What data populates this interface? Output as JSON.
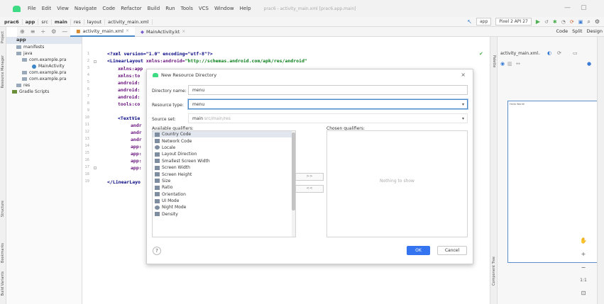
{
  "window": {
    "title": "prac6 - activity_main.xml [prac6.app.main]",
    "menu": [
      "File",
      "Edit",
      "View",
      "Navigate",
      "Code",
      "Refactor",
      "Build",
      "Run",
      "Tools",
      "VCS",
      "Window",
      "Help"
    ]
  },
  "breadcrumbs": [
    "prac6",
    "app",
    "src",
    "main",
    "res",
    "layout",
    "activity_main.xml"
  ],
  "toolbar": {
    "module": "app",
    "device": "Pixel 2 API 27"
  },
  "tabs": [
    {
      "label": "activity_main.xml"
    },
    {
      "label": "MainActivity.kt"
    }
  ],
  "view_modes": [
    "Code",
    "Split",
    "Design"
  ],
  "sidebar_left": [
    "Project",
    "Resource Manager",
    "Structure",
    "Bookmarks",
    "Build Variants"
  ],
  "project_tree": {
    "root": "app",
    "items": [
      "manifests",
      "java",
      "com.example.pra",
      "MainActivity",
      "com.example.pra",
      "com.example.pra",
      "res",
      "Gradle Scripts"
    ]
  },
  "editor": {
    "line_numbers": [
      "1",
      "2",
      "3",
      "4",
      "5",
      "6",
      "7",
      "8",
      "9",
      "10",
      "11",
      "12",
      "13",
      "14",
      "15",
      "16",
      "17",
      "18",
      "19"
    ],
    "lines": {
      "l1": "<?xml version=\"1.0\" encoding=\"utf-8\"?>",
      "l2_tag": "<LinearLayout",
      "l2_attr": "xmlns:android=",
      "l2_val": "\"http://schemas.android.com/apk/res/android\"",
      "l3": "xmlns:app",
      "l4": "xmlns:to",
      "l5": "android:",
      "l6": "android:",
      "l7": "android:",
      "l8": "tools:co",
      "l10": "<TextVie",
      "l11": "andr",
      "l12": "andr",
      "l13": "andr",
      "l14": "app:",
      "l15": "app:",
      "l16": "app:",
      "l17": "app:",
      "l19": "</LinearLayo"
    }
  },
  "design": {
    "layout_combo": "activity_main.xml",
    "canvas_label": "Hello World!"
  },
  "sidebar_right": [
    "Palette",
    "Component Tree"
  ],
  "zoom": {
    "plus": "+",
    "minus": "−",
    "ratio": "1:1"
  },
  "dialog": {
    "title": "New Resource Directory",
    "directory_name_label": "Directory name:",
    "directory_name_value": "menu",
    "resource_type_label": "Resource type:",
    "resource_type_value": "menu",
    "source_set_label": "Source set:",
    "source_set_value": "main",
    "source_set_path": "src/main/res",
    "available_label": "Available qualifiers:",
    "chosen_label": "Chosen qualifiers:",
    "qualifiers": [
      "Country Code",
      "Network Code",
      "Locale",
      "Layout Direction",
      "Smallest Screen Width",
      "Screen Width",
      "Screen Height",
      "Size",
      "Ratio",
      "Orientation",
      "UI Mode",
      "Night Mode",
      "Density"
    ],
    "nothing_to_show": "Nothing to show",
    "add_button": ">>",
    "remove_button": "<<",
    "help": "?",
    "ok": "OK",
    "cancel": "Cancel"
  }
}
